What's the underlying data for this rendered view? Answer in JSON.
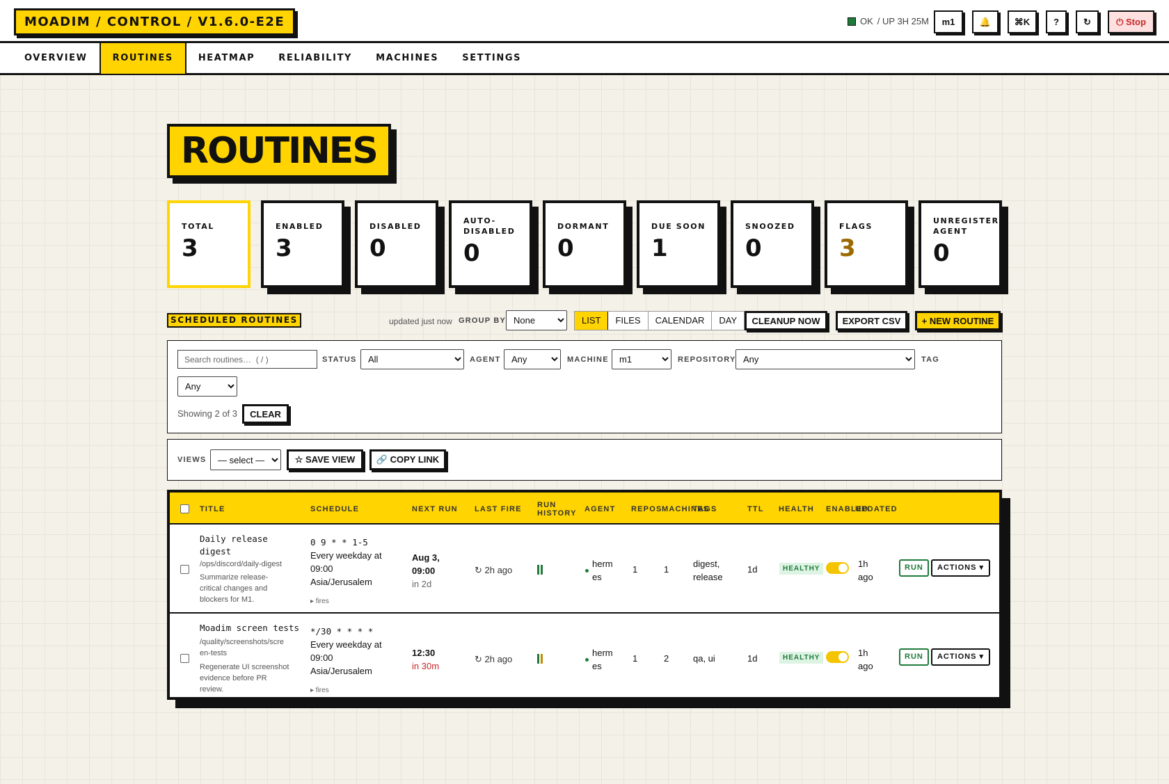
{
  "app": {
    "title": "MOADIM / CONTROL / V1.6.0-E2E"
  },
  "status": {
    "state": "OK",
    "uptime": "/ UP 3H 25M"
  },
  "topbar": {
    "machine": "m1",
    "bell": "🔔",
    "shortcut": "⌘K",
    "help": "?",
    "refresh": "↻",
    "stop": "⏻ Stop"
  },
  "nav": {
    "tabs": [
      "OVERVIEW",
      "ROUTINES",
      "HEATMAP",
      "RELIABILITY",
      "MACHINES",
      "SETTINGS"
    ],
    "active": "ROUTINES"
  },
  "page": {
    "title": "ROUTINES"
  },
  "stats": [
    {
      "label": "TOTAL",
      "value": "3"
    },
    {
      "label": "ENABLED",
      "value": "3"
    },
    {
      "label": "DISABLED",
      "value": "0"
    },
    {
      "label": "AUTO-",
      "label2": "DISABLED",
      "value": "0"
    },
    {
      "label": "DORMANT",
      "value": "0"
    },
    {
      "label": "DUE SOON",
      "value": "1"
    },
    {
      "label": "SNOOZED",
      "value": "0"
    },
    {
      "label": "FLAGS",
      "value": "3",
      "color": "#9a6a00"
    },
    {
      "label": "UNREGISTERED",
      "label2": "AGENT",
      "value": "0"
    }
  ],
  "section": {
    "title": "SCHEDULED ROUTINES",
    "updated": "updated just now",
    "group_by_label": "GROUP BY",
    "group_by_value": "None",
    "views": [
      "LIST",
      "FILES",
      "CALENDAR",
      "DAY"
    ],
    "active_view": "LIST",
    "cleanup": "CLEANUP NOW",
    "export": "EXPORT CSV",
    "new_routine": "+ NEW ROUTINE"
  },
  "filters": {
    "search_placeholder": "Search routines…  ( / )",
    "status_label": "STATUS",
    "status_value": "All",
    "agent_label": "AGENT",
    "agent_value": "Any",
    "machine_label": "MACHINE",
    "machine_value": "m1",
    "repo_label": "REPOSITORY",
    "repo_value": "Any",
    "tag_label": "TAG",
    "tag_value": "Any",
    "showing": "Showing 2 of 3",
    "clear": "CLEAR"
  },
  "views_bar": {
    "label": "VIEWS",
    "select": "— select —",
    "save": "☆ SAVE VIEW",
    "copy": "🔗 COPY LINK"
  },
  "table": {
    "headers": {
      "title": "TITLE",
      "schedule": "SCHEDULE",
      "next_run": "NEXT RUN",
      "last_fire": "LAST FIRE",
      "run_history_1": "RUN",
      "run_history_2": "HISTORY",
      "agent": "AGENT",
      "repos": "REPOS",
      "machines": "MACHINES",
      "tags": "TAGS",
      "ttl": "TTL",
      "health": "HEALTH",
      "enabled": "ENABLED",
      "updated": "UPDATED"
    },
    "rows": [
      {
        "title_1": "Daily release",
        "title_2": "digest",
        "path": "/ops/discord/daily-digest",
        "desc_1": "Summarize release-",
        "desc_2": "critical changes and",
        "desc_3": "blockers for M1.",
        "cron": "0 9 * * 1-5",
        "sched_1": "Every weekday at",
        "sched_2": "09:00",
        "sched_3": "Asia/Jerusalem",
        "fires": "▸ fires",
        "next_1": "Aug 3,",
        "next_2": "09:00",
        "next_rel": "in 2d",
        "last_fire": "↻ 2h ago",
        "history_colors": [
          "#1f7a3a",
          "#1f7a3a"
        ],
        "agent_1": "herm",
        "agent_2": "es",
        "repos": "1",
        "machines": "1",
        "tags_1": "digest,",
        "tags_2": "release",
        "ttl": "1d",
        "health": "HEALTHY",
        "updated_1": "1h",
        "updated_2": "ago",
        "run": "RUN",
        "actions": "ACTIONS ▾"
      },
      {
        "title_1": "Moadim screen tests",
        "title_2": "",
        "path_1": "/quality/screenshots/scre",
        "path_2": "en-tests",
        "desc_1": "Regenerate UI screenshot",
        "desc_2": "evidence before PR",
        "desc_3": "review.",
        "cron": "*/30 * * * *",
        "sched_1": "Every weekday at",
        "sched_2": "09:00",
        "sched_3": "Asia/Jerusalem",
        "fires": "▸ fires",
        "next_1": "12:30",
        "next_rel": "in 30m",
        "last_fire": "↻ 2h ago",
        "history_colors": [
          "#1f7a3a",
          "#c98a00"
        ],
        "agent_1": "herm",
        "agent_2": "es",
        "repos": "1",
        "machines": "2",
        "tags_1": "qa, ui",
        "ttl": "1d",
        "health": "HEALTHY",
        "updated_1": "1h",
        "updated_2": "ago",
        "run": "RUN",
        "actions": "ACTIONS ▾"
      }
    ]
  }
}
